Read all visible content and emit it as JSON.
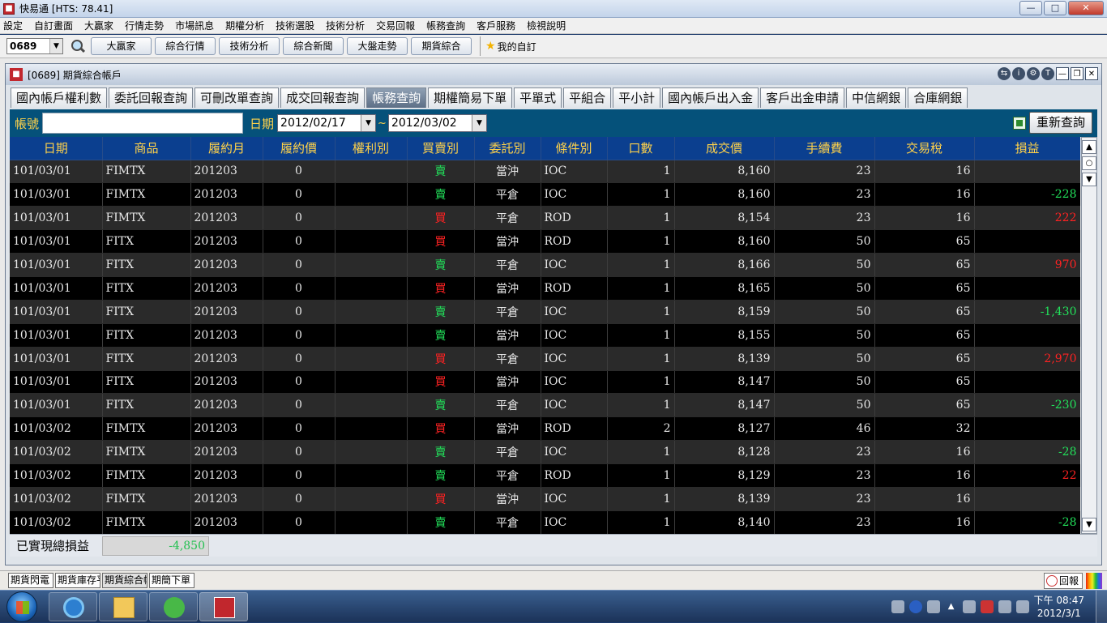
{
  "window": {
    "title": "快易通  [HTS: 78.41]"
  },
  "menu": [
    "設定",
    "自訂畫面",
    "大贏家",
    "行情走勢",
    "市場訊息",
    "期權分析",
    "技術選股",
    "技術分析",
    "交易回報",
    "帳務查詢",
    "客戶服務",
    "檢視說明"
  ],
  "toolbar": {
    "code_value": "0689",
    "buttons": [
      "大贏家",
      "綜合行情",
      "技術分析",
      "綜合新聞",
      "大盤走勢",
      "期貨綜合"
    ],
    "favorites_label": "我的自訂"
  },
  "child": {
    "title": "[0689] 期貨綜合帳戶",
    "tabs": [
      "國內帳戶權利數",
      "委託回報查詢",
      "可刪改單查詢",
      "成交回報查詢",
      "帳務查詢",
      "期權簡易下單",
      "平單式",
      "平組合",
      "平小計",
      "國內帳戶出入金",
      "客戶出金申請",
      "中信網銀",
      "合庫網銀"
    ],
    "active_tab": 4
  },
  "query": {
    "account_label": "帳號",
    "account_value": "",
    "date_label": "日期",
    "date_from": "2012/02/17",
    "date_to": "2012/03/02",
    "tilde": "~",
    "requery_label": "重新查詢"
  },
  "table": {
    "columns": [
      "日期",
      "商品",
      "履約月",
      "履約價",
      "權利別",
      "買賣別",
      "委託別",
      "條件別",
      "口數",
      "成交價",
      "手續費",
      "交易稅",
      "損益"
    ],
    "rows": [
      [
        "101/03/01",
        "FIMTX",
        "201203",
        "0",
        "",
        "賣",
        "當沖",
        "IOC",
        "1",
        "8,160",
        "23",
        "16",
        ""
      ],
      [
        "101/03/01",
        "FIMTX",
        "201203",
        "0",
        "",
        "賣",
        "平倉",
        "IOC",
        "1",
        "8,160",
        "23",
        "16",
        "-228"
      ],
      [
        "101/03/01",
        "FIMTX",
        "201203",
        "0",
        "",
        "買",
        "平倉",
        "ROD",
        "1",
        "8,154",
        "23",
        "16",
        "222"
      ],
      [
        "101/03/01",
        "FITX",
        "201203",
        "0",
        "",
        "買",
        "當沖",
        "ROD",
        "1",
        "8,160",
        "50",
        "65",
        ""
      ],
      [
        "101/03/01",
        "FITX",
        "201203",
        "0",
        "",
        "賣",
        "平倉",
        "IOC",
        "1",
        "8,166",
        "50",
        "65",
        "970"
      ],
      [
        "101/03/01",
        "FITX",
        "201203",
        "0",
        "",
        "買",
        "當沖",
        "ROD",
        "1",
        "8,165",
        "50",
        "65",
        ""
      ],
      [
        "101/03/01",
        "FITX",
        "201203",
        "0",
        "",
        "賣",
        "平倉",
        "IOC",
        "1",
        "8,159",
        "50",
        "65",
        "-1,430"
      ],
      [
        "101/03/01",
        "FITX",
        "201203",
        "0",
        "",
        "賣",
        "當沖",
        "IOC",
        "1",
        "8,155",
        "50",
        "65",
        ""
      ],
      [
        "101/03/01",
        "FITX",
        "201203",
        "0",
        "",
        "買",
        "平倉",
        "IOC",
        "1",
        "8,139",
        "50",
        "65",
        "2,970"
      ],
      [
        "101/03/01",
        "FITX",
        "201203",
        "0",
        "",
        "買",
        "當沖",
        "IOC",
        "1",
        "8,147",
        "50",
        "65",
        ""
      ],
      [
        "101/03/01",
        "FITX",
        "201203",
        "0",
        "",
        "賣",
        "平倉",
        "IOC",
        "1",
        "8,147",
        "50",
        "65",
        "-230"
      ],
      [
        "101/03/02",
        "FIMTX",
        "201203",
        "0",
        "",
        "買",
        "當沖",
        "ROD",
        "2",
        "8,127",
        "46",
        "32",
        ""
      ],
      [
        "101/03/02",
        "FIMTX",
        "201203",
        "0",
        "",
        "賣",
        "平倉",
        "IOC",
        "1",
        "8,128",
        "23",
        "16",
        "-28"
      ],
      [
        "101/03/02",
        "FIMTX",
        "201203",
        "0",
        "",
        "賣",
        "平倉",
        "ROD",
        "1",
        "8,129",
        "23",
        "16",
        "22"
      ],
      [
        "101/03/02",
        "FIMTX",
        "201203",
        "0",
        "",
        "買",
        "當沖",
        "IOC",
        "1",
        "8,139",
        "23",
        "16",
        ""
      ],
      [
        "101/03/02",
        "FIMTX",
        "201203",
        "0",
        "",
        "賣",
        "平倉",
        "IOC",
        "1",
        "8,140",
        "23",
        "16",
        "-28"
      ]
    ]
  },
  "summary": {
    "label": "已實現總損益",
    "value": "-4,850"
  },
  "bottom_tabs": [
    "期貨閃電",
    "期貨庫存平倉",
    "期貨綜合帳戶",
    "期簡下單"
  ],
  "bottom_active": 2,
  "huibao_label": "回報",
  "clock": {
    "time": "下午 08:47",
    "date": "2012/3/1"
  },
  "colors": {
    "buy": "#ff2222",
    "sell": "#22e05a",
    "header_bg": "#0b3f8f",
    "header_text": "#ffd24a",
    "query_bg": "#05517a"
  }
}
